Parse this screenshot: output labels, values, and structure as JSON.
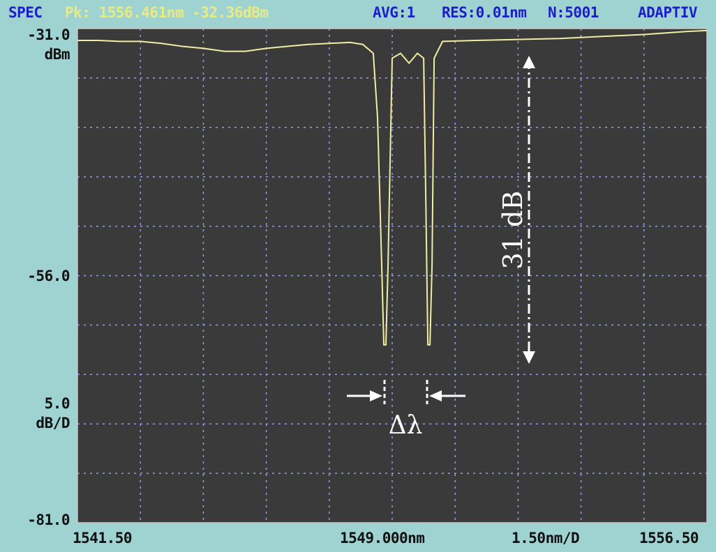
{
  "header": {
    "mode": "SPEC",
    "peak": "Pk: 1556.461nm -32.36dBm",
    "avg": "AVG:1",
    "res": "RES:0.01nm",
    "points": "N:5001",
    "sens": "ADAPTIV"
  },
  "y_axis": {
    "top_value": "-31.0",
    "top_unit": "dBm",
    "mid_value": "-56.0",
    "scale_value": "5.0",
    "scale_unit": "dB/D",
    "bottom_value": "-81.0"
  },
  "x_axis": {
    "start": "1541.50",
    "center": "1549.000nm",
    "span": "1.50nm/D",
    "stop": "1556.50"
  },
  "annotations": {
    "depth": "31 dB",
    "width": "Δλ"
  },
  "colors": {
    "header_blue": "#1d1ec9",
    "header_yellow": "#e9ea82",
    "plot_bg": "#3a3a3a",
    "grid": "#9b9bf0",
    "trace": "#f1eea2",
    "annotation": "#ffffff",
    "frame_bg": "#9fd3d2"
  },
  "chart_data": {
    "type": "line",
    "xlim": [
      1541.5,
      1556.5
    ],
    "ylim": [
      -81,
      -31
    ],
    "x_unit": "nm",
    "y_unit": "dBm",
    "grid": true,
    "series": [
      {
        "x": [
          1541.5,
          1542.0,
          1542.5,
          1543.0,
          1543.5,
          1544.0,
          1544.5,
          1545.0,
          1545.5,
          1546.0,
          1546.5,
          1547.0,
          1547.5,
          1548.0,
          1548.3,
          1548.55,
          1548.65,
          1548.75,
          1548.8,
          1548.85,
          1548.9,
          1549.0,
          1549.2,
          1549.4,
          1549.6,
          1549.75,
          1549.8,
          1549.85,
          1549.9,
          1549.95,
          1550.0,
          1550.2,
          1551.0,
          1552.0,
          1553.0,
          1554.0,
          1555.0,
          1556.0,
          1556.5
        ],
        "y": [
          -32.2,
          -32.2,
          -32.3,
          -32.3,
          -32.5,
          -32.8,
          -33.0,
          -33.3,
          -33.3,
          -33.0,
          -32.8,
          -32.6,
          -32.5,
          -32.4,
          -32.6,
          -33.5,
          -40.0,
          -55.0,
          -63.0,
          -63.0,
          -55.0,
          -34.0,
          -33.5,
          -34.5,
          -33.5,
          -34.0,
          -48.0,
          -63.0,
          -63.0,
          -55.0,
          -34.0,
          -32.3,
          -32.2,
          -32.1,
          -32.0,
          -31.8,
          -31.6,
          -31.3,
          -31.2
        ]
      }
    ]
  }
}
